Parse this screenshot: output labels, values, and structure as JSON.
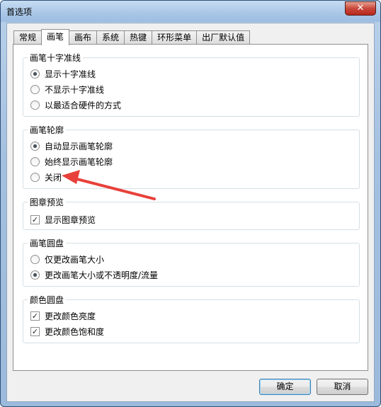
{
  "window": {
    "title": "首选项",
    "close_label": "✕"
  },
  "tabs": [
    {
      "label": "常规"
    },
    {
      "label": "画笔",
      "active": true
    },
    {
      "label": "画布"
    },
    {
      "label": "系统"
    },
    {
      "label": "热键"
    },
    {
      "label": "环形菜单"
    },
    {
      "label": "出厂默认值"
    }
  ],
  "groups": {
    "crosshair": {
      "title": "画笔十字准线",
      "options": [
        "显示十字准线",
        "不显示十字准线",
        "以最适合硬件的方式"
      ],
      "selected": 0
    },
    "outline": {
      "title": "画笔轮廓",
      "options": [
        "自动显示画笔轮廓",
        "始终显示画笔轮廓",
        "关闭"
      ],
      "selected": 0
    },
    "stamp": {
      "title": "图章预览",
      "checkbox": "显示图章预览",
      "checked": true
    },
    "brush_puck": {
      "title": "画笔圆盘",
      "options": [
        "仅更改画笔大小",
        "更改画笔大小或不透明度/流量"
      ],
      "selected": 1
    },
    "color_puck": {
      "title": "颜色圆盘",
      "checkboxes": [
        "更改颜色亮度",
        "更改颜色饱和度"
      ],
      "checked": [
        true,
        true
      ]
    }
  },
  "buttons": {
    "ok": "确定",
    "cancel": "取消"
  },
  "annotation": {
    "arrow_color": "#e8403a",
    "points_to": "关闭"
  },
  "colors": {
    "accent": "#3c7fb1",
    "titlebar": "#a9c6e6",
    "close": "#c8473a"
  }
}
